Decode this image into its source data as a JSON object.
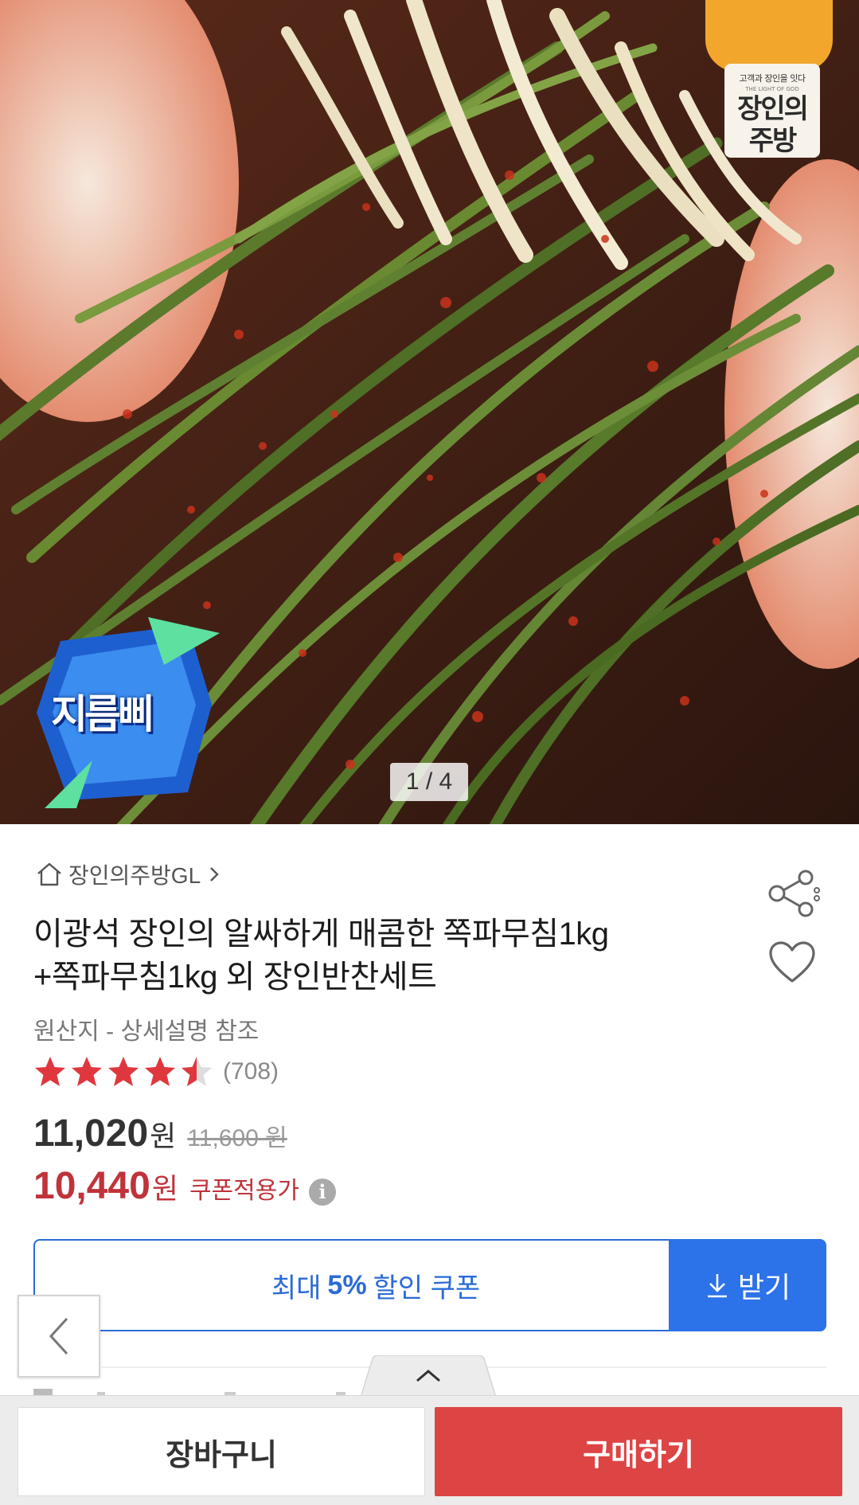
{
  "gallery": {
    "counter": "1 / 4",
    "brand_logo": {
      "tagline": "고객과 장인을 잇다",
      "sub": "THE LIGHT OF GOD",
      "name_line1": "장인의",
      "name_line2": "주방"
    },
    "promo_badge_text": "지름삐"
  },
  "store": {
    "name": "장인의주방GL",
    "icon": "home-icon"
  },
  "product": {
    "title_line1": "이광석 장인의 알싸하게 매콤한 쪽파무침1kg",
    "title_line2": "+쪽파무침1kg 외 장인반찬세트",
    "origin": "원산지 - 상세설명 참조",
    "rating": {
      "stars": 4.5,
      "max": 5,
      "count_text": "(708)"
    },
    "price": {
      "amount": "11,020",
      "unit": "원",
      "original": "11,600 원"
    },
    "coupon_price": {
      "amount": "10,440",
      "unit": "원",
      "label": "쿠폰적용가",
      "info_icon": "i"
    }
  },
  "coupon": {
    "prefix": "최대",
    "percent": "5%",
    "suffix": "할인 쿠폰",
    "get_label": "받기"
  },
  "actions": {
    "cart": "장바구니",
    "buy": "구매하기"
  },
  "colors": {
    "accent_blue": "#2c72e8",
    "price_red": "#c0333a",
    "buy_red": "#dd4444",
    "star_red": "#e0373e",
    "logo_orange": "#f2a62b"
  }
}
